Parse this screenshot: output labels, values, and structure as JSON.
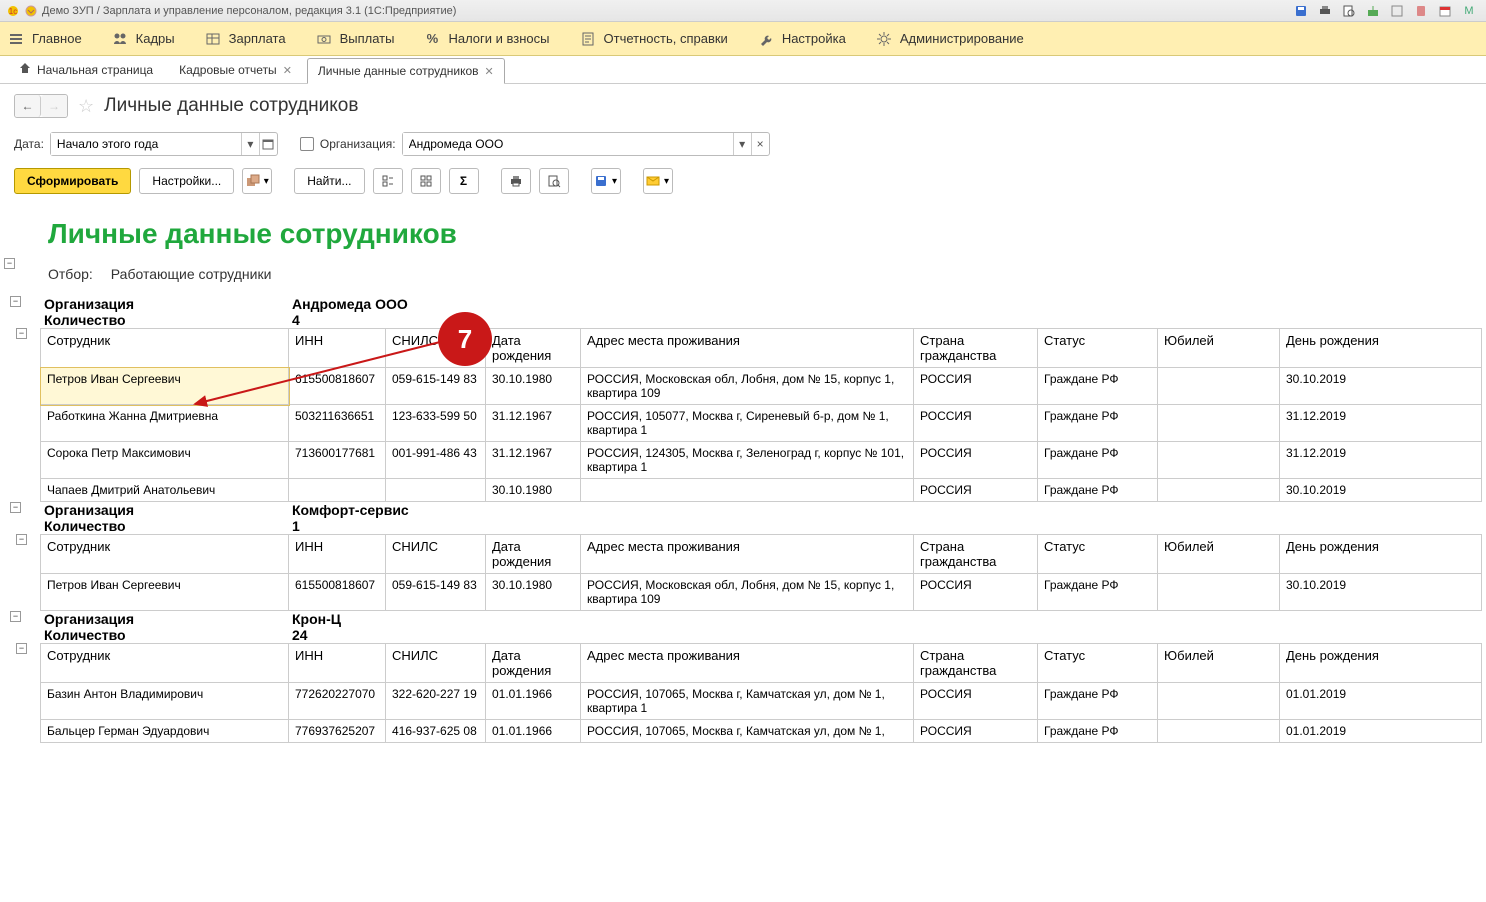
{
  "window_title": "Демо ЗУП / Зарплата и управление персоналом, редакция 3.1 (1С:Предприятие)",
  "menu": {
    "main": "Главное",
    "staff": "Кадры",
    "salary": "Зарплата",
    "payments": "Выплаты",
    "taxes": "Налоги и взносы",
    "reports": "Отчетность, справки",
    "settings": "Настройка",
    "admin": "Администрирование"
  },
  "tabs": {
    "home": "Начальная страница",
    "hr_reports": "Кадровые отчеты",
    "personal_data": "Личные данные сотрудников"
  },
  "page_title": "Личные данные сотрудников",
  "filter": {
    "date_label": "Дата:",
    "date_value": "Начало этого года",
    "org_label": "Организация:",
    "org_value": "Андромеда ООО"
  },
  "buttons": {
    "form": "Сформировать",
    "settings": "Настройки...",
    "find": "Найти..."
  },
  "report": {
    "title": "Личные данные сотрудников",
    "filter_label": "Отбор:",
    "filter_value": "Работающие сотрудники",
    "columns": {
      "employee": "Сотрудник",
      "inn": "ИНН",
      "snils": "СНИЛС",
      "dob": "Дата рождения",
      "addr": "Адрес места проживания",
      "ctz": "Страна гражданства",
      "status": "Статус",
      "jubilee": "Юбилей",
      "birthday": "День рождения"
    },
    "labels": {
      "org": "Организация",
      "count": "Количество"
    },
    "groups": [
      {
        "org": "Андромеда ООО",
        "count": "4",
        "rows": [
          {
            "emp": "Петров Иван Сергеевич",
            "inn": "615500818607",
            "snils": "059-615-149 83",
            "dob": "30.10.1980",
            "addr": "РОССИЯ, Московская обл, Лобня, дом № 15, корпус 1, квартира 109",
            "ctz": "РОССИЯ",
            "status": "Граждане РФ",
            "jub": "",
            "bday": "30.10.2019",
            "selected": true
          },
          {
            "emp": "Работкина Жанна Дмитриевна",
            "inn": "503211636651",
            "snils": "123-633-599 50",
            "dob": "31.12.1967",
            "addr": "РОССИЯ, 105077, Москва г, Сиреневый б-р, дом № 1, квартира 1",
            "ctz": "РОССИЯ",
            "status": "Граждане РФ",
            "jub": "",
            "bday": "31.12.2019"
          },
          {
            "emp": "Сорока Петр Максимович",
            "inn": "713600177681",
            "snils": "001-991-486 43",
            "dob": "31.12.1967",
            "addr": "РОССИЯ, 124305, Москва г, Зеленоград г, корпус № 101, квартира 1",
            "ctz": "РОССИЯ",
            "status": "Граждане РФ",
            "jub": "",
            "bday": "31.12.2019"
          },
          {
            "emp": "Чапаев Дмитрий Анатольевич",
            "inn": "",
            "snils": "",
            "dob": "30.10.1980",
            "addr": "",
            "ctz": "РОССИЯ",
            "status": "Граждане РФ",
            "jub": "",
            "bday": "30.10.2019"
          }
        ]
      },
      {
        "org": "Комфорт-сервис",
        "count": "1",
        "rows": [
          {
            "emp": "Петров Иван Сергеевич",
            "inn": "615500818607",
            "snils": "059-615-149 83",
            "dob": "30.10.1980",
            "addr": "РОССИЯ, Московская обл, Лобня, дом № 15, корпус 1, квартира 109",
            "ctz": "РОССИЯ",
            "status": "Граждане РФ",
            "jub": "",
            "bday": "30.10.2019"
          }
        ]
      },
      {
        "org": "Крон-Ц",
        "count": "24",
        "rows": [
          {
            "emp": "Базин Антон Владимирович",
            "inn": "772620227070",
            "snils": "322-620-227 19",
            "dob": "01.01.1966",
            "addr": "РОССИЯ, 107065, Москва г, Камчатская ул, дом № 1, квартира 1",
            "ctz": "РОССИЯ",
            "status": "Граждане РФ",
            "jub": "",
            "bday": "01.01.2019"
          },
          {
            "emp": "Бальцер Герман Эдуардович",
            "inn": "776937625207",
            "snils": "416-937-625 08",
            "dob": "01.01.1966",
            "addr": "РОССИЯ, 107065, Москва г, Камчатская ул, дом № 1,",
            "ctz": "РОССИЯ",
            "status": "Граждане РФ",
            "jub": "",
            "bday": "01.01.2019"
          }
        ]
      }
    ]
  },
  "annotation": {
    "number": "7"
  }
}
